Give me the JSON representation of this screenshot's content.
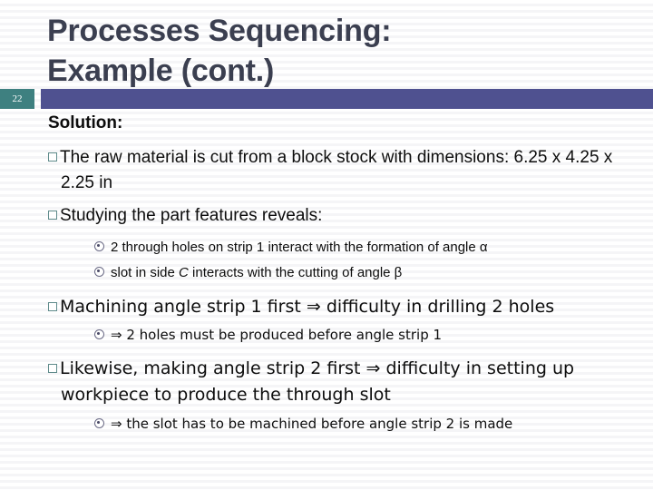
{
  "slide": {
    "page_number": "22",
    "title_lines": [
      "Processes Sequencing:",
      "Example (cont.)"
    ],
    "colors": {
      "title_text": "#3b3f50",
      "header_bar": "#4f5190",
      "page_badge": "#3e8080",
      "body_text": "#0d0d0d",
      "square_bullet": "#5f8b8b",
      "dot_bullet": "#6a6a85",
      "background": "#ffffff"
    }
  },
  "body": {
    "lead_label": "Solution:",
    "bullets": [
      {
        "marker": "hollow-square-bullet-icon",
        "level": 1,
        "text": "The raw material is cut from a block stock with dimensions: 6.25 x 4.25 x 2.25 in"
      },
      {
        "marker": "hollow-square-bullet-icon",
        "level": 1,
        "text": "Studying the part features reveals:"
      },
      {
        "marker": "circled-dot-bullet-icon",
        "level": 2,
        "text": "2 through holes on strip 1 interact with the formation of angle α"
      },
      {
        "marker": "circled-dot-bullet-icon",
        "level": 2,
        "text_before_italic": "slot in side ",
        "italic_part": "C",
        "text_after_italic": " interacts with the cutting of angle β"
      },
      {
        "marker": "hollow-square-bullet-icon",
        "level": 1,
        "text": "Machining angle strip 1 first ⇒ difficulty in drilling 2 holes"
      },
      {
        "marker": "circled-dot-bullet-icon",
        "level": 2,
        "text": "⇒ 2 holes must be produced before angle strip 1"
      },
      {
        "marker": "hollow-square-bullet-icon",
        "level": 1,
        "text": "Likewise, making angle strip 2 first ⇒ difficulty in setting up workpiece to produce the through slot"
      },
      {
        "marker": "circled-dot-bullet-icon",
        "level": 2,
        "text": "⇒ the slot has to be machined before angle strip 2 is made"
      }
    ]
  }
}
